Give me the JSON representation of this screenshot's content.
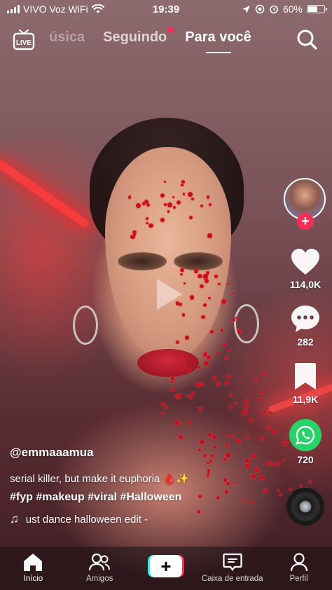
{
  "status_bar": {
    "carrier": "VIVO Voz WiFi",
    "time": "19:39",
    "battery": "60%",
    "battery_level": 0.6
  },
  "top_nav": {
    "live_label": "LIVE",
    "tabs": [
      {
        "label": "úsica",
        "state": "faded"
      },
      {
        "label": "Seguindo",
        "state": "inactive",
        "has_badge": true
      },
      {
        "label": "Para você",
        "state": "active"
      }
    ]
  },
  "rail": {
    "likes": "114,0K",
    "comments": "282",
    "saves": "11,9K",
    "shares": "720",
    "follow_symbol": "+"
  },
  "caption": {
    "username": "@emmaaamua",
    "description": "serial killer, but make it euphoria 🩸✨",
    "hashtags": "#fyp #makeup #viral #Halloween",
    "music_note": "♫",
    "music": "ust dance halloween edit -"
  },
  "bottom_nav": {
    "items": [
      {
        "label": "Início",
        "icon": "home-icon",
        "active": true
      },
      {
        "label": "Amigos",
        "icon": "friends-icon",
        "active": false
      },
      {
        "label": "+",
        "icon": "create-icon",
        "active": false
      },
      {
        "label": "Caixa de entrada",
        "icon": "inbox-icon",
        "active": false
      },
      {
        "label": "Perfil",
        "icon": "profile-icon",
        "active": false
      }
    ]
  },
  "colors": {
    "accent": "#fe2c55",
    "cyan": "#25f4ee",
    "whatsapp": "#25d366"
  }
}
